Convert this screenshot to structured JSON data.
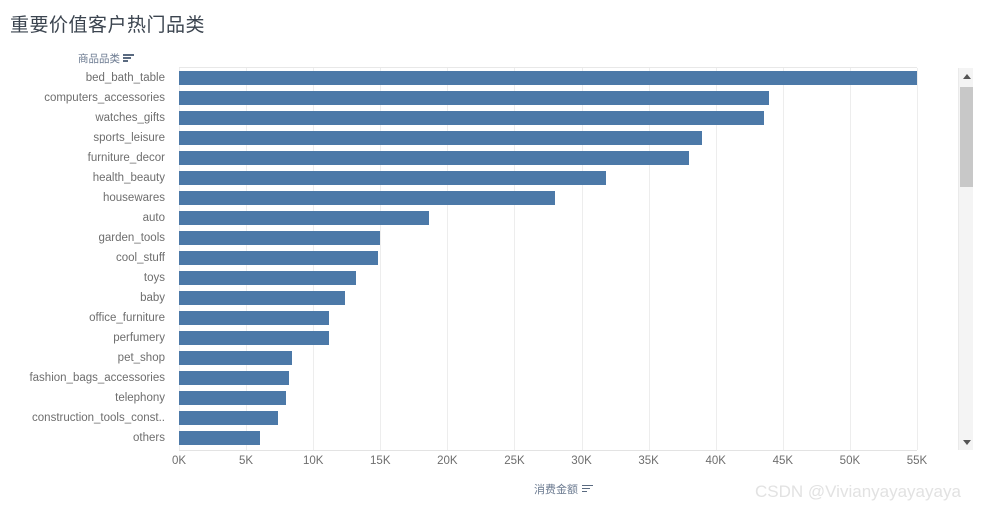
{
  "header": {
    "title": "重要价值客户热门品类"
  },
  "axes": {
    "y_field_label": "商品品类",
    "x_field_label": "消费金额",
    "sort_icon": "sort-descending-icon"
  },
  "watermark": "CSDN @Vivianyayayayaya",
  "scrollbar": {
    "up_icon": "chevron-up-icon",
    "down_icon": "chevron-down-icon"
  },
  "colors": {
    "bar": "#4c79a8",
    "gridline": "#ededed",
    "tick_text": "#6e6e6e",
    "field_text": "#6b7a90",
    "title": "#3b444f",
    "watermark": "#e2e2e2",
    "scrollbar_track": "#f4f4f4",
    "scrollbar_thumb": "#c8c8c8"
  },
  "chart_data": {
    "type": "bar",
    "orientation": "horizontal",
    "title": "重要价值客户热门品类",
    "xlabel": "消费金额",
    "ylabel": "商品品类",
    "xlim": [
      0,
      55000
    ],
    "grid": true,
    "legend": null,
    "xticks": [
      0,
      5000,
      10000,
      15000,
      20000,
      25000,
      30000,
      35000,
      40000,
      45000,
      50000,
      55000
    ],
    "xticklabels": [
      "0K",
      "5K",
      "10K",
      "15K",
      "20K",
      "25K",
      "30K",
      "35K",
      "40K",
      "45K",
      "50K",
      "55K"
    ],
    "categories": [
      "bed_bath_table",
      "computers_accessories",
      "watches_gifts",
      "sports_leisure",
      "furniture_decor",
      "health_beauty",
      "housewares",
      "auto",
      "garden_tools",
      "cool_stuff",
      "toys",
      "baby",
      "office_furniture",
      "perfumery",
      "pet_shop",
      "fashion_bags_accessories",
      "telephony",
      "construction_tools_const..",
      "others"
    ],
    "values": [
      55000,
      44000,
      43600,
      39000,
      38000,
      31800,
      28000,
      18600,
      15000,
      14800,
      13200,
      12400,
      11200,
      11200,
      8400,
      8200,
      8000,
      7400,
      6000
    ]
  }
}
